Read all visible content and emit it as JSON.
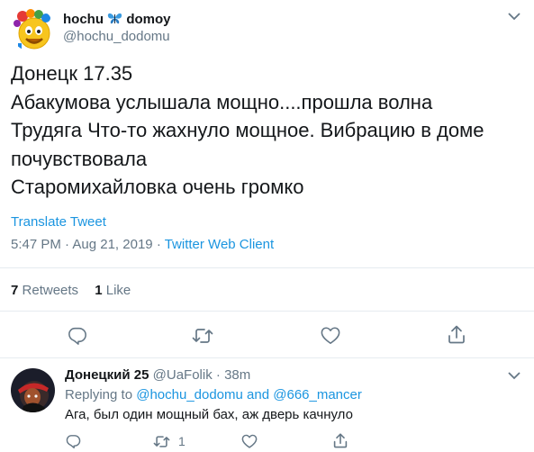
{
  "tweet": {
    "author": {
      "name_part1": "hochu",
      "name_emoji": "🦋",
      "name_part2": "domoy",
      "handle": "@hochu_dodomu"
    },
    "lines": [
      "Донецк 17.35",
      "Абакумова услышала мощно....прошла волна",
      "Трудяга Что-то жахнуло мощное. Вибрацию в доме",
      "почувствовала",
      "Старомихайловка очень громко"
    ],
    "translate": "Translate Tweet",
    "time": "5:47 PM",
    "dot1": "·",
    "date": "Aug 21, 2019",
    "dot2": "·",
    "client": "Twitter Web Client",
    "retweets_count": "7",
    "retweets_label": "Retweets",
    "likes_count": "1",
    "likes_label": "Like"
  },
  "reply": {
    "name": "Донецкий 25",
    "handle": "@UaFolik",
    "dot": "·",
    "time": "38m",
    "replying_prefix": "Replying to",
    "mention1": "@hochu_dodomu",
    "and": "and",
    "mention2": "@666_mancer",
    "text": "Ага, был один мощный бах, аж дверь качнуло",
    "retweet_count": "1"
  },
  "icons": {
    "caret": "chevron-down-icon",
    "reply": "reply-icon",
    "retweet": "retweet-icon",
    "like": "heart-icon",
    "share": "share-icon"
  },
  "colors": {
    "link": "#1b95e0",
    "secondary": "#657786",
    "text": "#14171a",
    "border": "#e6ecf0"
  }
}
